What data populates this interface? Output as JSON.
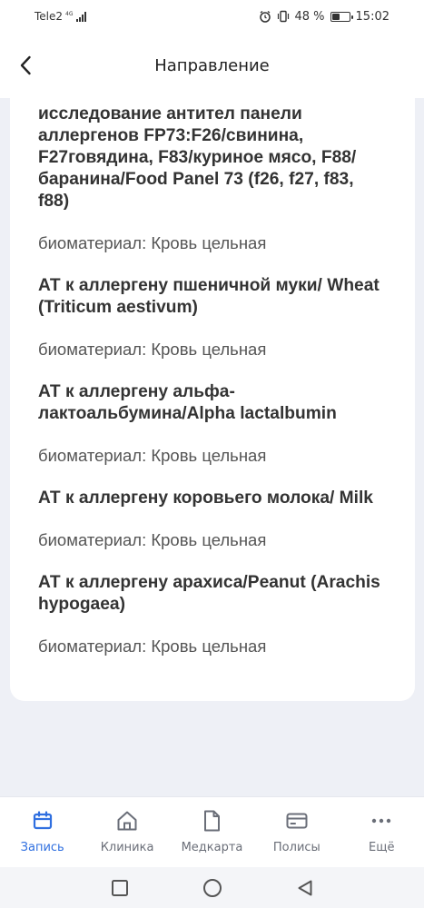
{
  "status": {
    "carrier": "Tele2",
    "network": "4G",
    "battery_percent": "48 %",
    "battery_level": 0.48,
    "time": "15:02"
  },
  "header": {
    "title": "Направление"
  },
  "tests": [
    {
      "name": "исследование антител панели аллергенов FP73:F26/свинина, F27говядина, F83/куриное мясо, F88/баранина/Food Panel 73 (f26, f27, f83, f88)",
      "biomaterial": "биоматериал: Кровь цельная"
    },
    {
      "name": "АТ к аллергену пшеничной муки/ Wheat (Triticum aestivum)",
      "biomaterial": "биоматериал: Кровь цельная"
    },
    {
      "name": "АТ к аллергену альфа-лактоальбумина/Alpha lactalbumin",
      "biomaterial": "биоматериал: Кровь цельная"
    },
    {
      "name": "АТ к аллергену коровьего молока/ Milk",
      "biomaterial": "биоматериал: Кровь цельная"
    },
    {
      "name": "АТ к аллергену арахиса/Peanut (Arachis hypogaea)",
      "biomaterial": "биоматериал: Кровь цельная"
    }
  ],
  "nav": {
    "items": [
      {
        "label": "Запись",
        "icon": "calendar-icon"
      },
      {
        "label": "Клиника",
        "icon": "home-icon"
      },
      {
        "label": "Медкарта",
        "icon": "document-icon"
      },
      {
        "label": "Полисы",
        "icon": "card-icon"
      },
      {
        "label": "Ещё",
        "icon": "more-icon"
      }
    ],
    "active_color": "#2f6fe0",
    "inactive_color": "#6a6e78"
  }
}
